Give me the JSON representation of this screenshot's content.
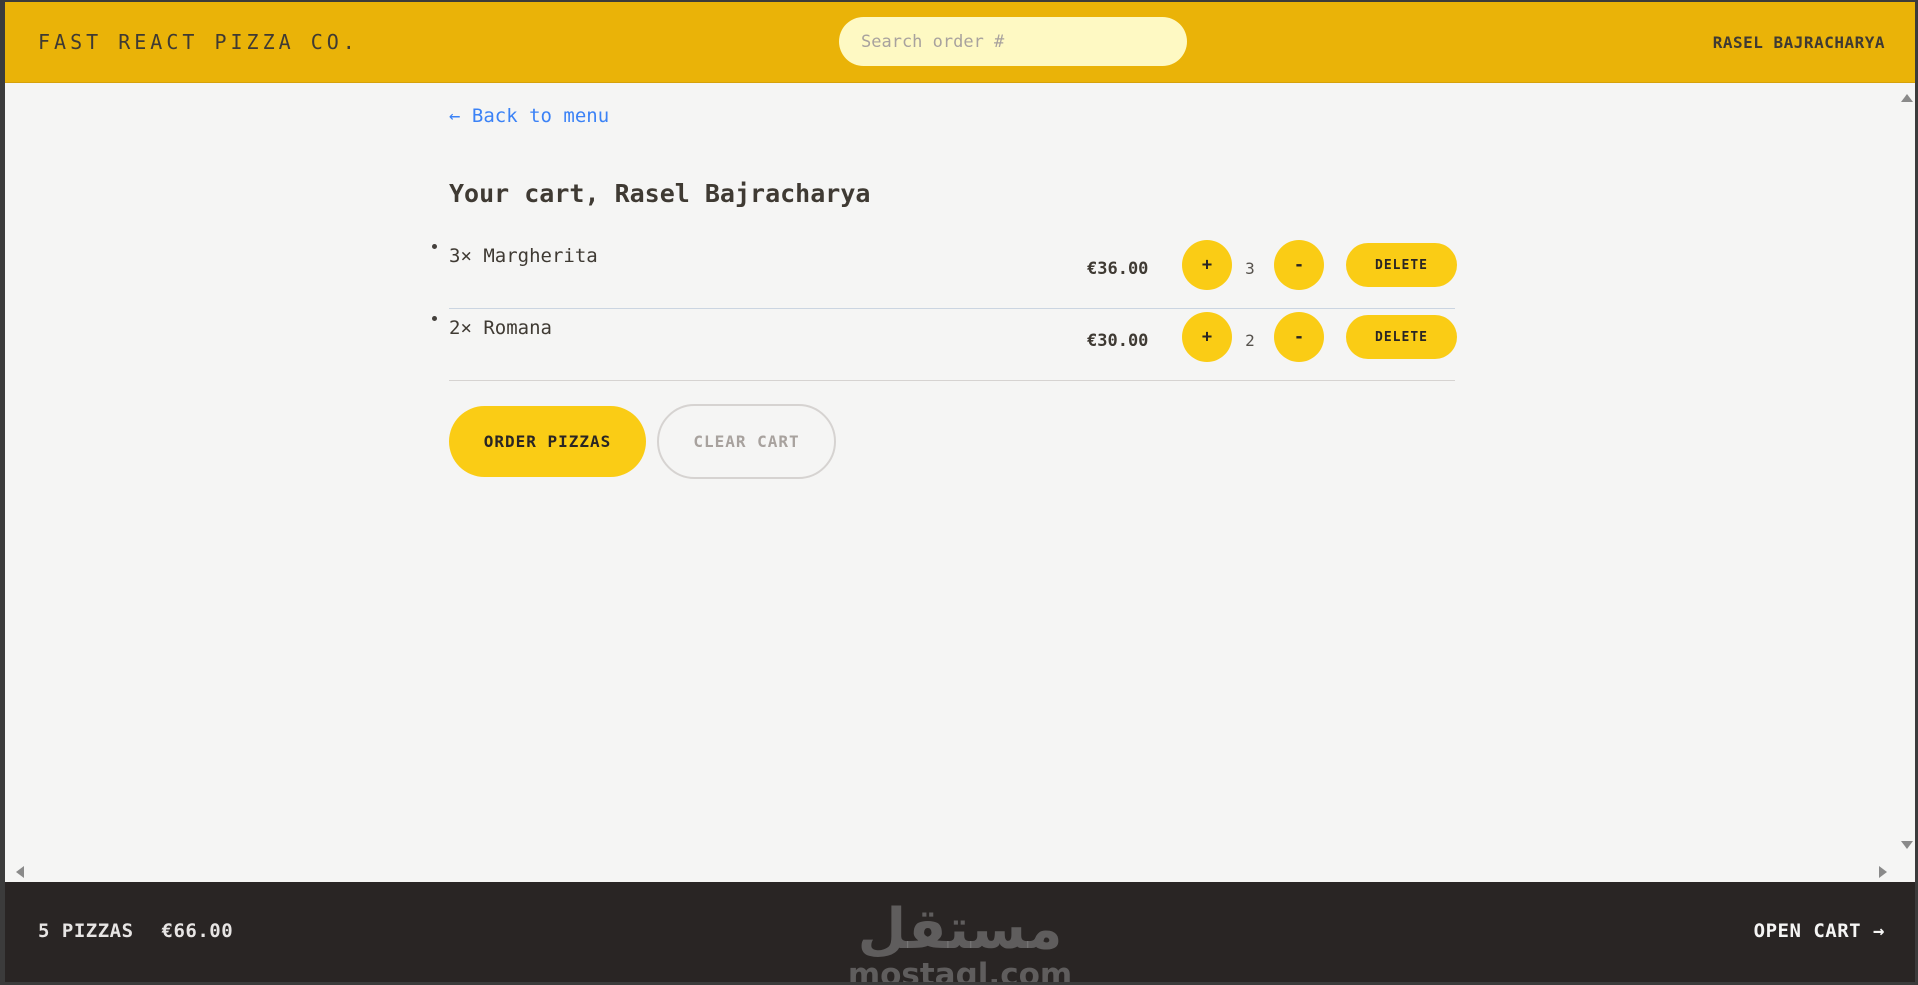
{
  "header": {
    "logo": "FAST REACT PIZZA CO.",
    "search_placeholder": "Search order #",
    "username": "RASEL BAJRACHARYA"
  },
  "main": {
    "back_link": "← Back to menu",
    "title": "Your cart, Rasel Bajracharya",
    "items": [
      {
        "name": "3× Margherita",
        "price": "€36.00",
        "quantity": "3",
        "plus": "+",
        "minus": "-",
        "delete": "DELETE"
      },
      {
        "name": "2× Romana",
        "price": "€30.00",
        "quantity": "2",
        "plus": "+",
        "minus": "-",
        "delete": "DELETE"
      }
    ],
    "order_button": "ORDER PIZZAS",
    "clear_button": "CLEAR CART"
  },
  "footer": {
    "pizza_count": "5 PIZZAS",
    "total": "€66.00",
    "open_cart": "OPEN CART →"
  },
  "watermark": {
    "arabic": "مستقل",
    "text": "mostaql.com"
  },
  "colors": {
    "header_bg": "#eab308",
    "accent": "#facc15",
    "footer_bg": "#292524",
    "link": "#3b82f6",
    "page_bg": "#f5f5f4"
  }
}
